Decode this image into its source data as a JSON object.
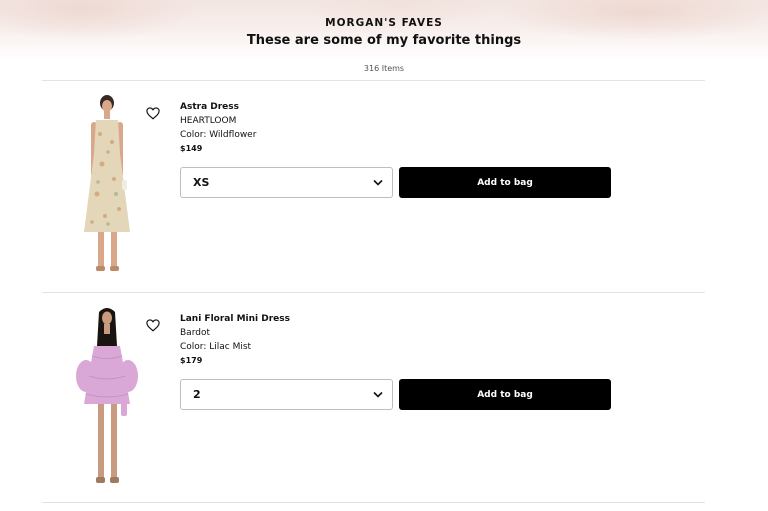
{
  "header": {
    "kicker": "MORGAN'S FAVES",
    "title": "These are some of my favorite things",
    "item_count": "316 Items"
  },
  "products": [
    {
      "name": "Astra Dress",
      "brand": "HEARTLOOM",
      "color": "Color: Wildflower",
      "price": "$149",
      "size": "XS",
      "add_label": "Add to bag",
      "favorite_icon": "heart-outline-icon",
      "select_icon": "chevron-down-icon"
    },
    {
      "name": "Lani Floral Mini Dress",
      "brand": "Bardot",
      "color": "Color: Lilac Mist",
      "price": "$179",
      "size": "2",
      "add_label": "Add to bag",
      "favorite_icon": "heart-outline-icon",
      "select_icon": "chevron-down-icon"
    }
  ],
  "colors": {
    "button_bg": "#000000",
    "divider": "#e3e3e3",
    "hero_tint": "#f3e6e2"
  }
}
